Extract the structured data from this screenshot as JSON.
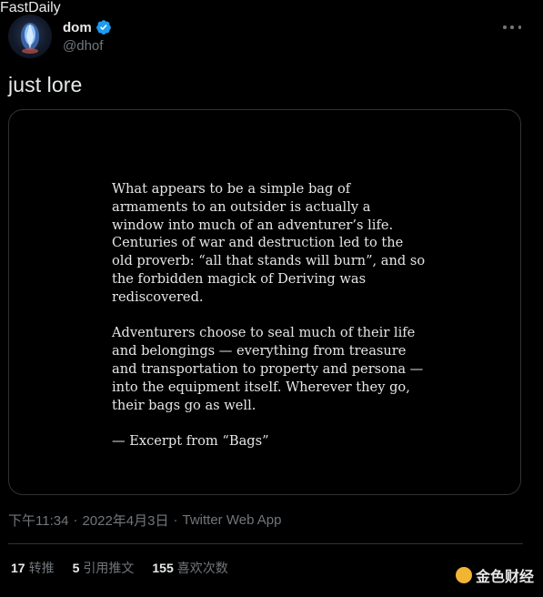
{
  "author": {
    "display_name": "dom",
    "handle": "@dhof",
    "verified_icon": "verified-badge-icon"
  },
  "tweet": {
    "text": "just lore"
  },
  "media": {
    "paragraph1": "What appears to be a simple bag of armaments to an outsider is actually a window into much of an adventurer’s life. Centuries of war and destruction led to the old proverb: “all that stands will burn”, and so the forbidden magick of Deriving was rediscovered.",
    "paragraph2": "Adventurers choose to seal much of their life and belongings — everything from treasure and transportation to property and persona — into the equipment itself. Wherever they go, their bags go as well.",
    "attribution": "— Excerpt from “Bags”"
  },
  "meta": {
    "time": "下午11:34",
    "separator": "·",
    "date": "2022年4月3日",
    "source": "Twitter Web App"
  },
  "stats": {
    "retweets_count": "17",
    "retweets_label": "转推",
    "quotes_count": "5",
    "quotes_label": "引用推文",
    "likes_count": "155",
    "likes_label": "喜欢次数"
  },
  "watermark": {
    "text": "金色财经",
    "overlay": "FastDaily"
  },
  "colors": {
    "background": "#000000",
    "primary_text": "#e7e9ea",
    "secondary_text": "#71767b",
    "border": "#2f3336",
    "verified": "#1d9bf0"
  }
}
